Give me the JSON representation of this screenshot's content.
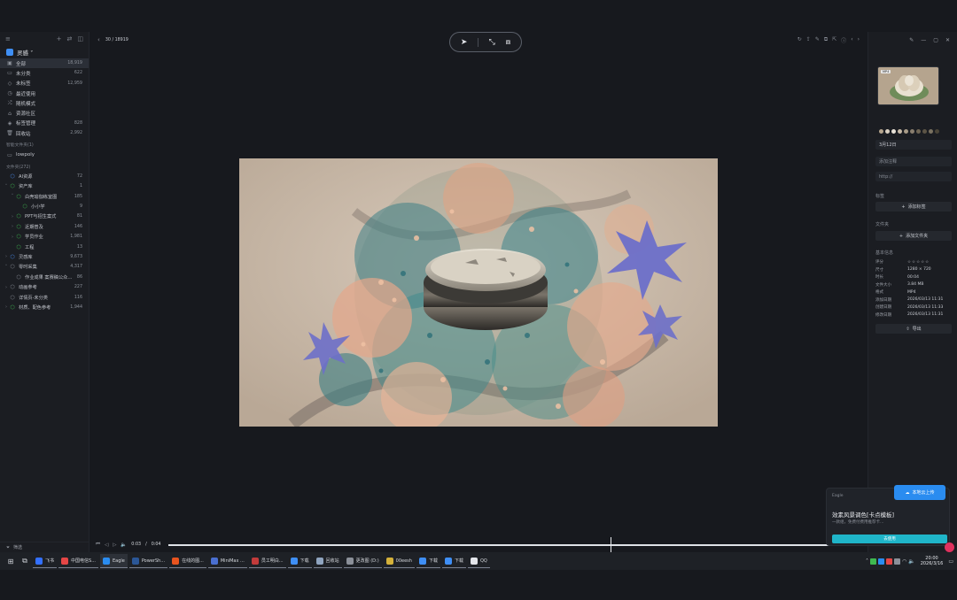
{
  "sidebar": {
    "library_name": "灵感 ˅",
    "nav": [
      {
        "label": "全部",
        "count": "18,919",
        "icon": "grid-icon",
        "glyph": "▣"
      },
      {
        "label": "未分类",
        "count": "622",
        "icon": "folder-icon",
        "glyph": "▭"
      },
      {
        "label": "未标签",
        "count": "12,959",
        "icon": "tag-icon",
        "glyph": "◇"
      },
      {
        "label": "最近使用",
        "count": "",
        "icon": "clock-icon",
        "glyph": "◷"
      },
      {
        "label": "随机模式",
        "count": "",
        "icon": "shuffle-icon",
        "glyph": "⤮"
      },
      {
        "label": "资源社区",
        "count": "",
        "icon": "community-icon",
        "glyph": "⌂"
      },
      {
        "label": "标签管理",
        "count": "828",
        "icon": "tags-icon",
        "glyph": "◈"
      },
      {
        "label": "回收站",
        "count": "2,992",
        "icon": "trash-icon",
        "glyph": "🗑"
      }
    ],
    "smart_title": "智能文件夹(1)",
    "smart_folders": [
      {
        "label": "lowpoly",
        "count": ""
      }
    ],
    "folders_title": "文件夹(272)",
    "folders": [
      {
        "label": "AI资源",
        "count": "72",
        "arrow": "",
        "indent": 0,
        "color": "#4a8df0"
      },
      {
        "label": "资产库",
        "count": "1",
        "arrow": "˅",
        "indent": 0,
        "color": "#3fb950"
      },
      {
        "label": "白壳瑜伽练室图",
        "count": "185",
        "arrow": "˅",
        "indent": 1,
        "color": "#3fb950"
      },
      {
        "label": "小小学",
        "count": "9",
        "arrow": "",
        "indent": 2,
        "color": "#3fb950"
      },
      {
        "label": "PPT与招生案式",
        "count": "81",
        "arrow": "›",
        "indent": 1,
        "color": "#3fb950"
      },
      {
        "label": "近期普及",
        "count": "146",
        "arrow": "›",
        "indent": 1,
        "color": "#3fb950"
      },
      {
        "label": "学员作业",
        "count": "1,981",
        "arrow": "›",
        "indent": 1,
        "color": "#3fb950"
      },
      {
        "label": "工程",
        "count": "13",
        "arrow": "",
        "indent": 1,
        "color": "#3fb950"
      },
      {
        "label": "灵感库",
        "count": "9,673",
        "arrow": "›",
        "indent": 0,
        "color": "#4a8df0"
      },
      {
        "label": "零时采集",
        "count": "4,317",
        "arrow": "˅",
        "indent": 0,
        "color": "#8b9099"
      },
      {
        "label": "作业成果 案赛稿公众…",
        "count": "86",
        "arrow": "",
        "indent": 1,
        "color": "#8b9099"
      },
      {
        "label": "动画参考",
        "count": "227",
        "arrow": "›",
        "indent": 0,
        "color": "#8b9099"
      },
      {
        "label": "详情页-未分类",
        "count": "116",
        "arrow": "",
        "indent": 0,
        "color": "#8b9099"
      },
      {
        "label": "材质、配色参考",
        "count": "1,944",
        "arrow": "›",
        "indent": 0,
        "color": "#3fb950"
      }
    ],
    "filter_label": "筛选"
  },
  "viewer": {
    "counter": "30 / 18919",
    "current_time": "0:03",
    "separator": "/",
    "total_time": "0:04",
    "rate": "1x",
    "progress": 0.65
  },
  "inspector": {
    "format_badge": "MP4",
    "swatches": [
      "#b6a58e",
      "#d9cfc0",
      "#e8e1d6",
      "#c7b9a6",
      "#a89b87",
      "#8a7e6e",
      "#6f6554",
      "#5c5446",
      "#7a7160",
      "#4a4438"
    ],
    "title_value": "3月12日",
    "note_placeholder": "添加注释",
    "url_placeholder": "http://",
    "tags_label": "标签",
    "add_tag": "添加标签",
    "folder_label": "文件夹",
    "add_folder": "添加文件夹",
    "info_label": "基本信息",
    "props": [
      {
        "k": "评分",
        "v": "☆☆☆☆☆"
      },
      {
        "k": "尺寸",
        "v": "1280 × 720"
      },
      {
        "k": "时长",
        "v": "00:04"
      },
      {
        "k": "文件大小",
        "v": "3.84 MB"
      },
      {
        "k": "格式",
        "v": "MP4"
      },
      {
        "k": "添加日期",
        "v": "2026/03/13 11:31"
      },
      {
        "k": "创建日期",
        "v": "2026/03/13 11:33"
      },
      {
        "k": "修改日期",
        "v": "2026/03/13 11:31"
      }
    ],
    "export_label": "导出"
  },
  "notification": {
    "app": "Eagle",
    "badge": "本地云上传",
    "title": "效素风景调色[卡点模板]",
    "sub": "一款组，免费付费用推荐卡…",
    "button": "去使用"
  },
  "taskbar": {
    "apps": [
      {
        "label": "飞书",
        "color": "#3370ff"
      },
      {
        "label": "中国电信S...",
        "color": "#e54646"
      },
      {
        "label": "Eagle",
        "color": "#2a8cf0",
        "active": true
      },
      {
        "label": "PowerSh...",
        "color": "#2b5797"
      },
      {
        "label": "在线的图...",
        "color": "#e8541f"
      },
      {
        "label": "MiniMax ...",
        "color": "#4a6fd0"
      },
      {
        "label": "员工明白...",
        "color": "#c23b3b"
      },
      {
        "label": "下载",
        "color": "#3f8ff5"
      },
      {
        "label": "回收站",
        "color": "#8fa4bf"
      },
      {
        "label": "更改图 (D:)",
        "color": "#8b9099"
      },
      {
        "label": "00eesh",
        "color": "#d4b13a"
      },
      {
        "label": "下载",
        "color": "#3f8ff5"
      },
      {
        "label": "下载",
        "color": "#3f8ff5"
      },
      {
        "label": "QQ",
        "color": "#e3e5ea"
      }
    ],
    "time": "20:00",
    "date": "2026/3/16"
  }
}
